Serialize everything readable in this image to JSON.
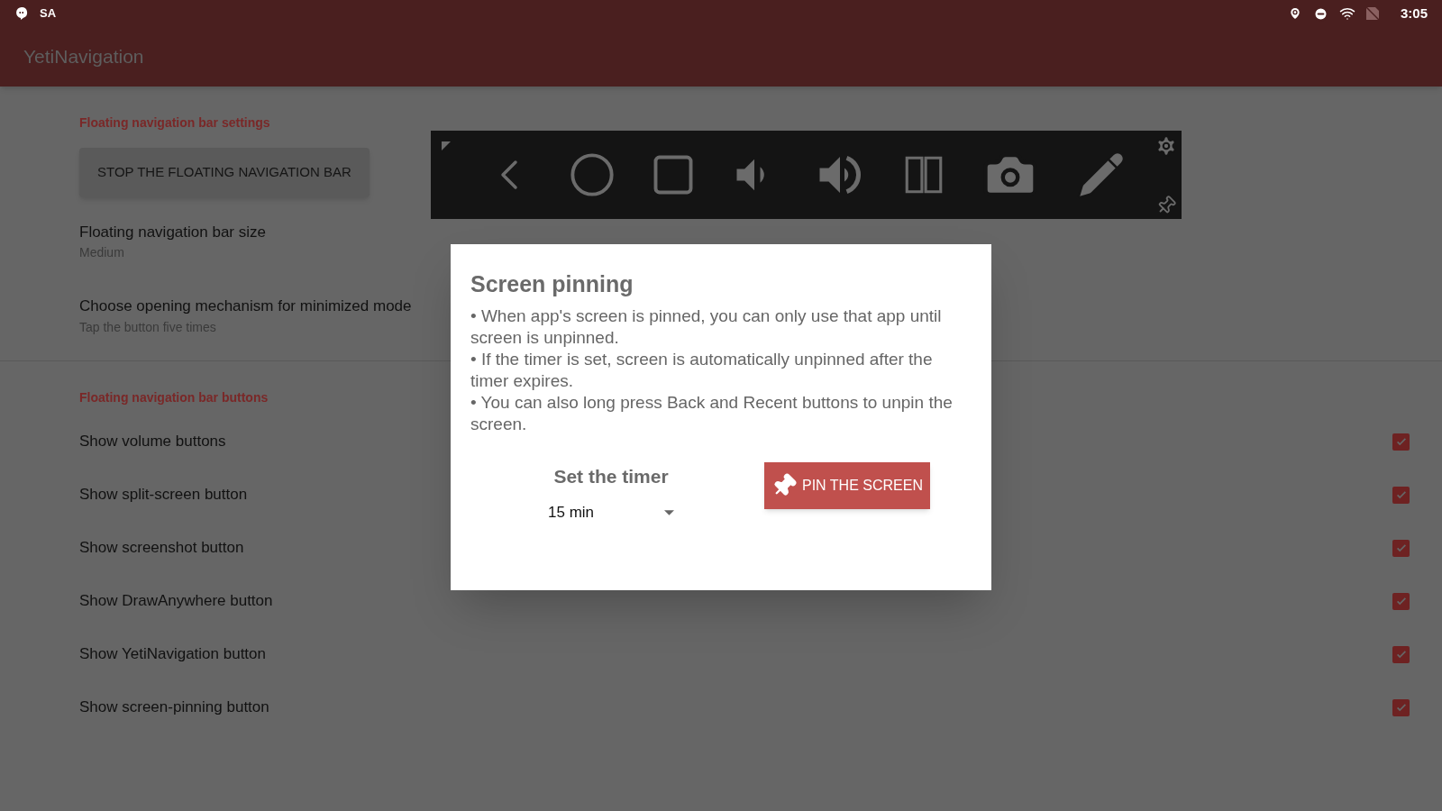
{
  "status_bar": {
    "carrier": "SA",
    "time": "3:05"
  },
  "app_bar": {
    "title": "YetiNavigation"
  },
  "sections": [
    {
      "header": "Floating navigation bar settings",
      "items": [
        {
          "kind": "button",
          "label": "STOP THE FLOATING NAVIGATION BAR"
        },
        {
          "kind": "text",
          "title": "Floating navigation bar size",
          "summary": "Medium"
        },
        {
          "kind": "text",
          "title": "Choose opening mechanism for minimized mode",
          "summary": "Tap the button five times"
        }
      ]
    },
    {
      "header": "Floating navigation bar buttons",
      "items": [
        {
          "kind": "checkbox",
          "title": "Show volume buttons",
          "checked": true
        },
        {
          "kind": "checkbox",
          "title": "Show split-screen button",
          "checked": true
        },
        {
          "kind": "checkbox",
          "title": "Show screenshot button",
          "checked": true
        },
        {
          "kind": "checkbox",
          "title": "Show DrawAnywhere button",
          "checked": true
        },
        {
          "kind": "checkbox",
          "title": "Show YetiNavigation button",
          "checked": true
        },
        {
          "kind": "checkbox",
          "title": "Show screen-pinning button",
          "checked": true
        }
      ]
    }
  ],
  "dialog": {
    "title": "Screen pinning",
    "paragraphs": [
      "• When app's screen is pinned, you can only use that app until screen is unpinned.",
      "• If the timer is set, screen is automatically unpinned after the timer expires.",
      "• You can also long press Back and Recent buttons to unpin the screen."
    ],
    "timer_label": "Set the timer",
    "timer_value": "15 min",
    "pin_button": "PIN THE SCREEN"
  }
}
